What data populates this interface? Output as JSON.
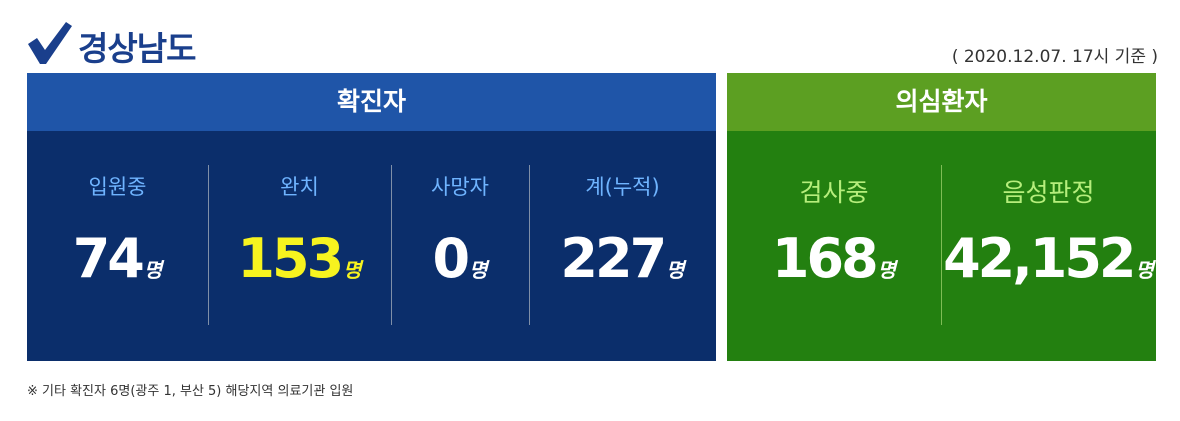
{
  "header": {
    "region": "경상남도",
    "date": "( 2020.12.07. 17시 기준 )"
  },
  "colors": {
    "title": "#1a3f8c",
    "confirmed_head": "#1f55a8",
    "confirmed_body": "#0b2e6b",
    "suspected_head": "#5c9f22",
    "suspected_body": "#238010",
    "highlight": "#f7f31f"
  },
  "confirmed": {
    "title": "확진자",
    "stats": [
      {
        "label": "입원중",
        "value": "74",
        "unit": "명"
      },
      {
        "label": "완치",
        "value": "153",
        "unit": "명"
      },
      {
        "label": "사망자",
        "value": "0",
        "unit": "명"
      },
      {
        "label": "계(누적)",
        "value": "227",
        "unit": "명"
      }
    ]
  },
  "suspected": {
    "title": "의심환자",
    "stats": [
      {
        "label": "검사중",
        "value": "168",
        "unit": "명"
      },
      {
        "label": "음성판정",
        "value": "42,152",
        "unit": "명"
      }
    ]
  },
  "footnote": "※ 기타 확진자 6명(광주 1, 부산 5) 해당지역 의료기관 입원",
  "icons": [
    "check-icon"
  ]
}
